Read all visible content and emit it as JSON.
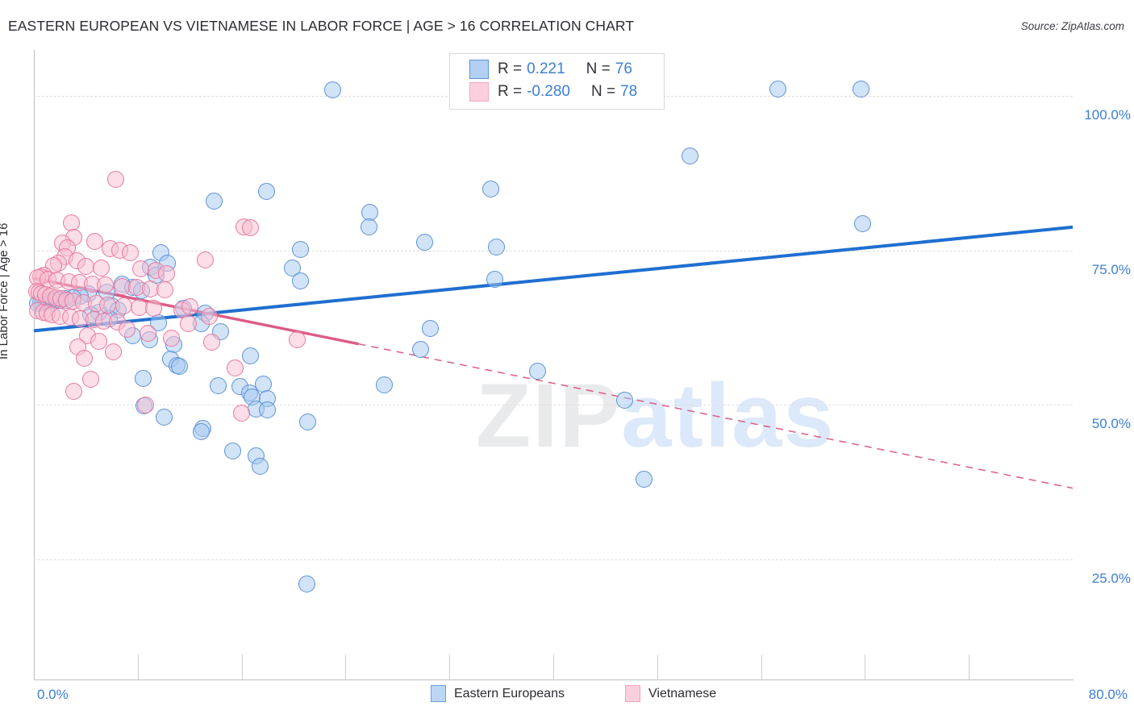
{
  "header": {
    "title": "EASTERN EUROPEAN VS VIETNAMESE IN LABOR FORCE | AGE > 16 CORRELATION CHART",
    "source": "Source: ZipAtlas.com"
  },
  "watermark": {
    "part1": "ZIP",
    "part2": "atlas"
  },
  "legend_box": {
    "row1": {
      "r_label": "R =",
      "r_value": "0.221",
      "n_label": "N =",
      "n_value": "76",
      "color": "#b3d0f2"
    },
    "row2": {
      "r_label": "R =",
      "r_value": "-0.280",
      "n_label": "N =",
      "n_value": "78",
      "color": "#fbcfde"
    }
  },
  "bottom_legend": {
    "series1": {
      "label": "Eastern Europeans",
      "color": "#bcd6f5"
    },
    "series2": {
      "label": "Vietnamese",
      "color": "#fbcfde"
    }
  },
  "axes": {
    "y_title": "In Labor Force | Age > 16",
    "y_ticks": [
      "100.0%",
      "75.0%",
      "50.0%",
      "25.0%"
    ],
    "x_min_label": "0.0%",
    "x_max_label": "80.0%"
  },
  "chart_data": {
    "type": "scatter",
    "title": "EASTERN EUROPEAN VS VIETNAMESE IN LABOR FORCE | AGE > 16 CORRELATION CHART",
    "xlabel": "",
    "ylabel": "In Labor Force | Age > 16",
    "xlim": [
      0,
      80
    ],
    "ylim": [
      5.5,
      107.5
    ],
    "x_unit": "%",
    "y_unit": "%",
    "grid": true,
    "y_gridlines": [
      100.0,
      75.0,
      50.0,
      25.0
    ],
    "legend_position": "bottom-center",
    "series": [
      {
        "name": "Eastern Europeans",
        "color": "#a3c8f0",
        "edge_color": "#5b92d8",
        "R": 0.221,
        "N": 76,
        "trendline": {
          "style": "solid",
          "color": "#1f6fd0",
          "x0": 0,
          "y0": 62.0,
          "x1": 80,
          "y1": 78.8
        },
        "points": [
          [
            23.0,
            101.0
          ],
          [
            57.3,
            101.2
          ],
          [
            63.7,
            101.2
          ],
          [
            50.5,
            90.3
          ],
          [
            35.2,
            85.0
          ],
          [
            63.8,
            79.3
          ],
          [
            13.9,
            83.0
          ],
          [
            17.9,
            84.6
          ],
          [
            25.9,
            81.2
          ],
          [
            25.8,
            78.8
          ],
          [
            30.1,
            76.3
          ],
          [
            35.6,
            75.6
          ],
          [
            20.5,
            75.2
          ],
          [
            9.8,
            74.6
          ],
          [
            10.3,
            73.0
          ],
          [
            9.0,
            72.3
          ],
          [
            19.9,
            72.2
          ],
          [
            9.4,
            71.0
          ],
          [
            35.5,
            70.4
          ],
          [
            20.5,
            70.1
          ],
          [
            6.8,
            69.6
          ],
          [
            7.6,
            69.0
          ],
          [
            8.3,
            68.5
          ],
          [
            5.6,
            68.3
          ],
          [
            4.2,
            68.0
          ],
          [
            3.6,
            67.6
          ],
          [
            3.0,
            67.3
          ],
          [
            2.4,
            67.2
          ],
          [
            2.0,
            67.0
          ],
          [
            1.6,
            66.9
          ],
          [
            1.2,
            66.8
          ],
          [
            0.9,
            66.7
          ],
          [
            0.7,
            66.6
          ],
          [
            0.5,
            66.5
          ],
          [
            0.3,
            66.4
          ],
          [
            6.0,
            66.0
          ],
          [
            6.5,
            65.4
          ],
          [
            5.0,
            65.0
          ],
          [
            4.4,
            64.6
          ],
          [
            11.5,
            65.6
          ],
          [
            13.2,
            64.8
          ],
          [
            5.8,
            63.9
          ],
          [
            9.6,
            63.3
          ],
          [
            12.9,
            63.2
          ],
          [
            30.5,
            62.4
          ],
          [
            14.4,
            61.9
          ],
          [
            7.6,
            61.2
          ],
          [
            8.9,
            60.5
          ],
          [
            10.8,
            59.7
          ],
          [
            29.8,
            59.0
          ],
          [
            16.7,
            58.0
          ],
          [
            10.5,
            57.4
          ],
          [
            11.0,
            56.4
          ],
          [
            11.2,
            56.3
          ],
          [
            38.8,
            55.5
          ],
          [
            8.4,
            54.3
          ],
          [
            14.2,
            53.1
          ],
          [
            15.9,
            53.0
          ],
          [
            17.7,
            53.4
          ],
          [
            27.0,
            53.3
          ],
          [
            16.6,
            51.9
          ],
          [
            16.8,
            51.3
          ],
          [
            18.0,
            51.0
          ],
          [
            45.5,
            50.8
          ],
          [
            8.5,
            49.9
          ],
          [
            17.1,
            49.3
          ],
          [
            18.0,
            49.2
          ],
          [
            10.0,
            48.0
          ],
          [
            21.1,
            47.2
          ],
          [
            13.0,
            46.2
          ],
          [
            12.9,
            45.7
          ],
          [
            15.3,
            42.5
          ],
          [
            17.1,
            41.8
          ],
          [
            17.4,
            40.0
          ],
          [
            47.0,
            38.0
          ],
          [
            21.0,
            21.0
          ]
        ]
      },
      {
        "name": "Vietnamese",
        "color": "#f8bed0",
        "edge_color": "#e8789f",
        "R": -0.28,
        "N": 78,
        "trendline": {
          "style": "solid-then-dashed",
          "color": "#dd5c86",
          "x0": 0,
          "y0": 70.5,
          "x1": 80,
          "y1": 36.5,
          "dash_start_x": 25.0
        },
        "points": [
          [
            6.3,
            86.5
          ],
          [
            2.9,
            79.5
          ],
          [
            16.2,
            78.8
          ],
          [
            16.7,
            78.7
          ],
          [
            3.1,
            77.1
          ],
          [
            4.7,
            76.5
          ],
          [
            2.2,
            76.2
          ],
          [
            2.6,
            75.4
          ],
          [
            5.9,
            75.3
          ],
          [
            6.6,
            75.0
          ],
          [
            7.4,
            74.6
          ],
          [
            13.2,
            73.5
          ],
          [
            2.4,
            74.0
          ],
          [
            3.3,
            73.4
          ],
          [
            1.9,
            73.0
          ],
          [
            1.5,
            72.6
          ],
          [
            4.0,
            72.4
          ],
          [
            5.2,
            72.2
          ],
          [
            8.2,
            72.0
          ],
          [
            9.4,
            71.8
          ],
          [
            10.2,
            71.3
          ],
          [
            0.8,
            71.0
          ],
          [
            0.5,
            70.8
          ],
          [
            0.3,
            70.6
          ],
          [
            1.1,
            70.4
          ],
          [
            1.8,
            70.2
          ],
          [
            2.7,
            70.0
          ],
          [
            3.5,
            69.8
          ],
          [
            4.5,
            69.6
          ],
          [
            5.5,
            69.4
          ],
          [
            6.8,
            69.2
          ],
          [
            7.9,
            69.0
          ],
          [
            9.0,
            68.8
          ],
          [
            10.1,
            68.6
          ],
          [
            0.2,
            68.4
          ],
          [
            0.4,
            68.2
          ],
          [
            0.6,
            68.0
          ],
          [
            0.9,
            67.8
          ],
          [
            1.3,
            67.6
          ],
          [
            1.7,
            67.4
          ],
          [
            2.1,
            67.2
          ],
          [
            2.5,
            67.0
          ],
          [
            3.0,
            66.8
          ],
          [
            3.8,
            66.6
          ],
          [
            4.8,
            66.4
          ],
          [
            5.7,
            66.2
          ],
          [
            6.9,
            66.0
          ],
          [
            8.1,
            65.8
          ],
          [
            9.2,
            65.6
          ],
          [
            11.4,
            65.4
          ],
          [
            0.3,
            65.2
          ],
          [
            0.7,
            65.0
          ],
          [
            1.0,
            64.8
          ],
          [
            1.4,
            64.6
          ],
          [
            2.0,
            64.4
          ],
          [
            2.8,
            64.2
          ],
          [
            3.6,
            64.0
          ],
          [
            4.6,
            63.8
          ],
          [
            5.4,
            63.6
          ],
          [
            6.4,
            63.4
          ],
          [
            12.0,
            65.9
          ],
          [
            13.5,
            64.3
          ],
          [
            11.9,
            63.1
          ],
          [
            7.2,
            62.2
          ],
          [
            8.8,
            61.6
          ],
          [
            4.1,
            61.2
          ],
          [
            5.0,
            60.3
          ],
          [
            10.6,
            60.8
          ],
          [
            13.7,
            60.1
          ],
          [
            20.3,
            60.5
          ],
          [
            3.4,
            59.4
          ],
          [
            6.1,
            58.6
          ],
          [
            3.9,
            57.5
          ],
          [
            4.4,
            54.2
          ],
          [
            3.1,
            52.2
          ],
          [
            8.6,
            50.0
          ],
          [
            15.5,
            56.0
          ],
          [
            16.0,
            48.6
          ]
        ]
      }
    ]
  }
}
